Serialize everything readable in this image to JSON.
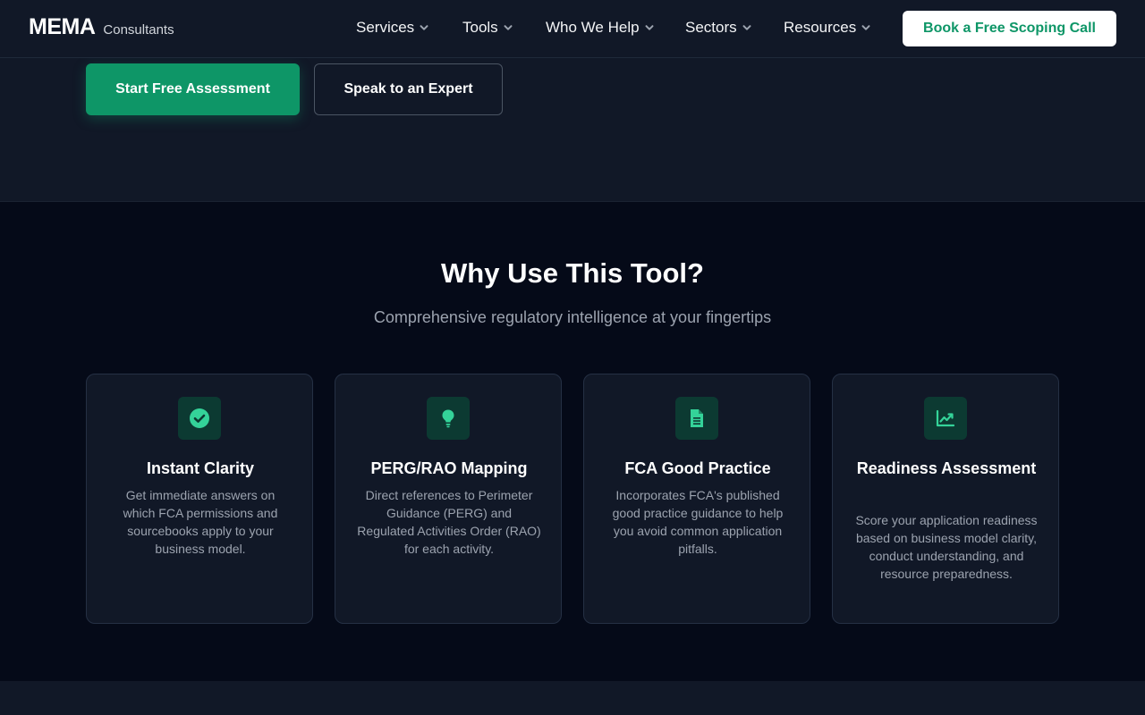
{
  "brand": {
    "name": "MEMA",
    "tagline": "Consultants"
  },
  "nav": {
    "items": [
      {
        "label": "Services"
      },
      {
        "label": "Tools"
      },
      {
        "label": "Who We Help"
      },
      {
        "label": "Sectors"
      },
      {
        "label": "Resources"
      }
    ],
    "cta": "Book a Free Scoping Call"
  },
  "hero": {
    "primary_button": "Start Free Assessment",
    "secondary_button": "Speak to an Expert"
  },
  "why": {
    "title": "Why Use This Tool?",
    "subtitle": "Comprehensive regulatory intelligence at your fingertips",
    "cards": [
      {
        "icon": "check-circle-icon",
        "title": "Instant Clarity",
        "text": "Get immediate answers on which FCA permissions and sourcebooks apply to your business model."
      },
      {
        "icon": "lightbulb-icon",
        "title": "PERG/RAO Mapping",
        "text": "Direct references to Perimeter Guidance (PERG) and Regulated Activities Order (RAO) for each activity."
      },
      {
        "icon": "document-icon",
        "title": "FCA Good Practice",
        "text": "Incorporates FCA's published good practice guidance to help you avoid common application pitfalls."
      },
      {
        "icon": "chart-line-icon",
        "title": "Readiness Assessment",
        "text": "Score your application readiness based on business model clarity, conduct understanding, and resource preparedness."
      }
    ]
  },
  "colors": {
    "accent": "#0e9667",
    "icon_bg": "#0c3a32",
    "icon_fg": "#34d399",
    "background": "#111827",
    "section_bg": "#050a18"
  }
}
